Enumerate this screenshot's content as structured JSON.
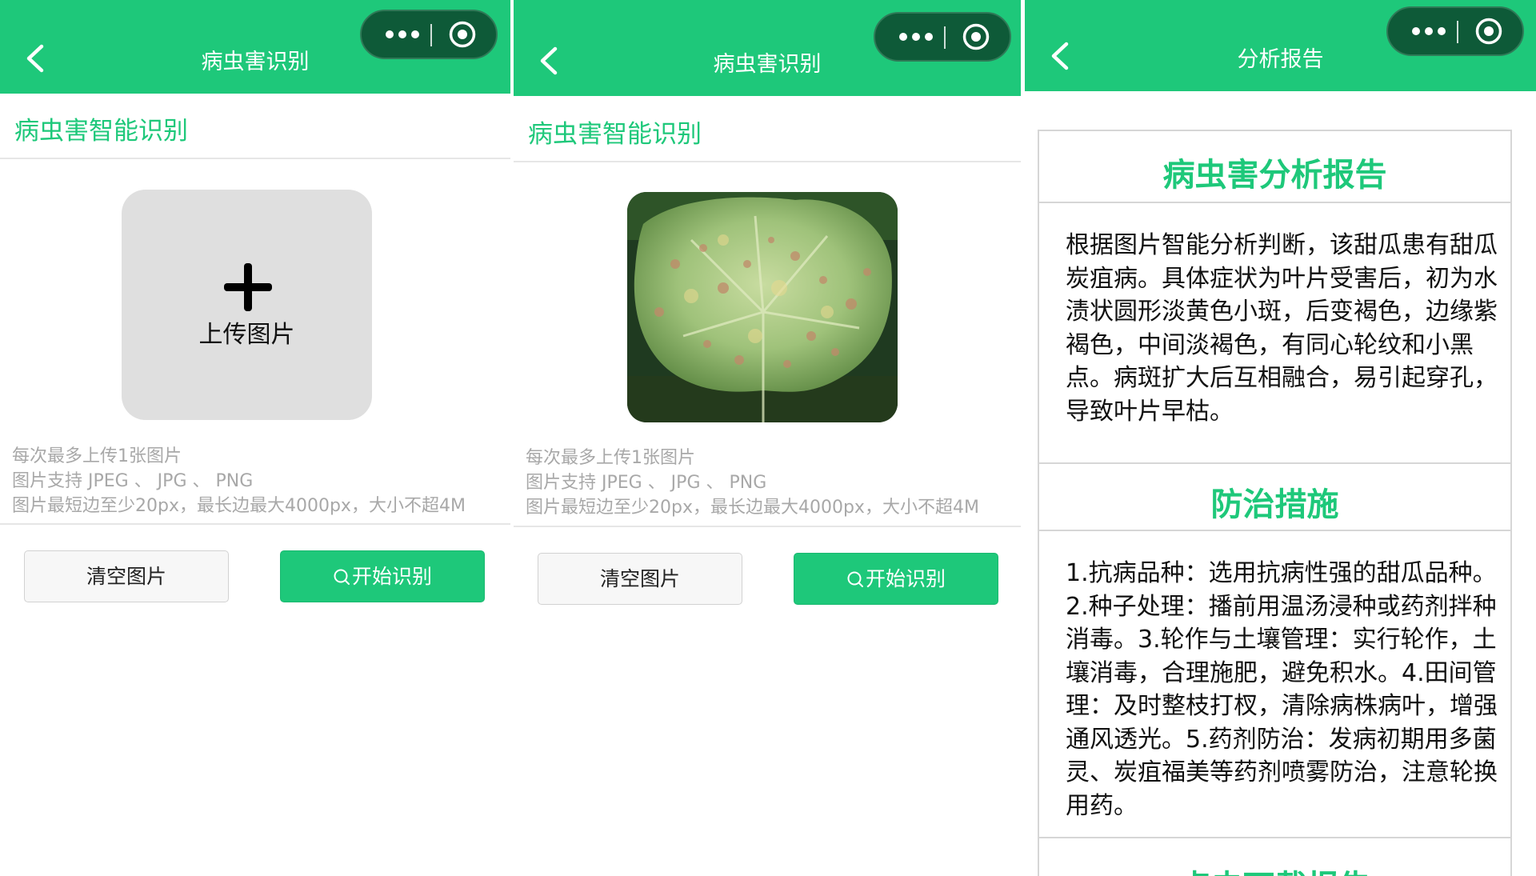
{
  "identify": {
    "header_title": "病虫害识别",
    "section_title": "病虫害智能识别",
    "upload_label": "上传图片",
    "hints": [
      "每次最多上传1张图片",
      "图片支持 JPEG 、 JPG 、 PNG",
      "图片最短边至少20px，最长边最大4000px，大小不超4M"
    ],
    "clear_button": "清空图片",
    "start_button": "开始识别"
  },
  "report": {
    "header_title": "分析报告",
    "analysis_title": "病虫害分析报告",
    "analysis_text": "根据图片智能分析判断，该甜瓜患有甜瓜炭疽病。具体症状为叶片受害后，初为水渍状圆形淡黄色小斑，后变褐色，边缘紫褐色，中间淡褐色，有同心轮纹和小黑点。病斑扩大后互相融合，易引起穿孔，导致叶片早枯。",
    "measures_title": "防治措施",
    "measures_text": "1.抗病品种：选用抗病性强的甜瓜品种。2.种子处理：播前用温汤浸种或药剂拌种消毒。3.轮作与土壤管理：实行轮作，土壤消毒，合理施肥，避免积水。4.田间管理：及时整枝打杈，清除病株病叶，增强通风透光。5.药剂防治：发病初期用多菌灵、炭疽福美等药剂喷雾防治，注意轮换用药。",
    "download_title": "点击下载报告"
  },
  "colors": {
    "brand_green": "#1ec87a",
    "capsule_dark": "#0e5a38",
    "upload_bg": "#dfdfdf",
    "hint_gray": "#a8a8a8"
  },
  "icons": {
    "back": "chevron-left-icon",
    "more": "more-dots-icon",
    "close": "target-circle-icon",
    "plus": "plus-icon",
    "search": "search-icon"
  }
}
